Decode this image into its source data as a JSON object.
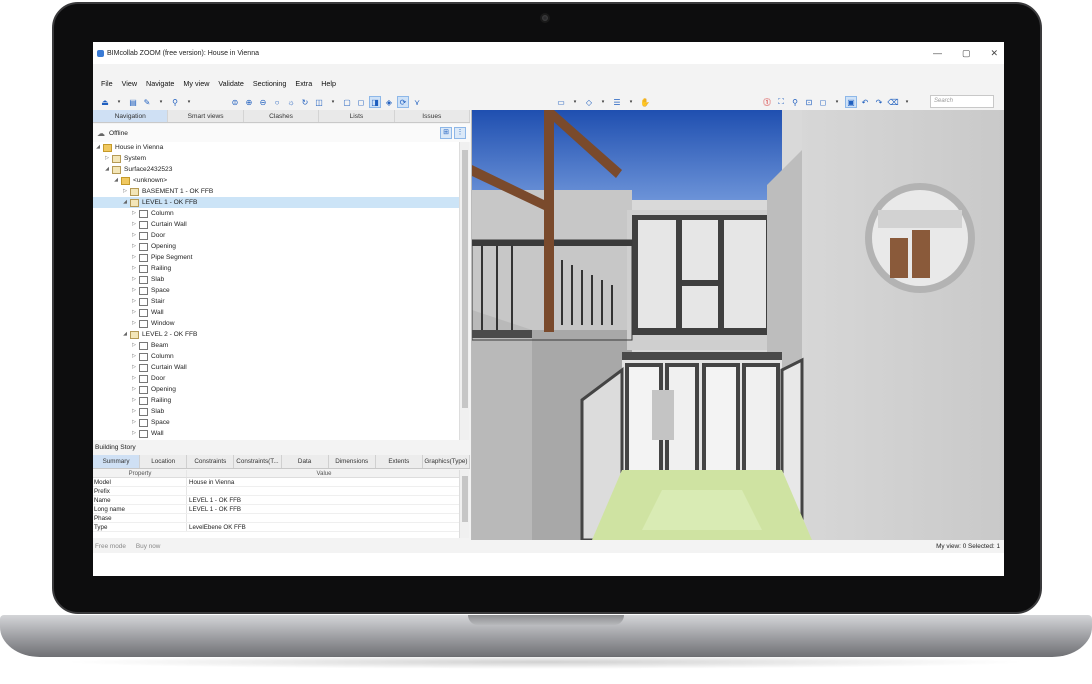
{
  "window": {
    "title": "BIMcollab ZOOM (free version): House in Vienna",
    "controls": [
      "—",
      "▢",
      "✕"
    ]
  },
  "menu": [
    "File",
    "View",
    "Navigate",
    "My view",
    "Validate",
    "Sectioning",
    "Extra",
    "Help"
  ],
  "search": {
    "placeholder": "Search"
  },
  "panel_tabs": [
    "Navigation",
    "Smart views",
    "Clashes",
    "Lists",
    "Issues"
  ],
  "offline_label": "Offline",
  "tree": [
    {
      "label": "House in Vienna",
      "depth": 0,
      "expanded": true,
      "icon": "folder"
    },
    {
      "label": "System",
      "depth": 1,
      "expanded": false,
      "icon": "building"
    },
    {
      "label": "Surface2432523",
      "depth": 1,
      "expanded": true,
      "icon": "site"
    },
    {
      "label": "<unknown>",
      "depth": 2,
      "expanded": true,
      "icon": "folder"
    },
    {
      "label": "BASEMENT 1 - OK FFB",
      "depth": 3,
      "expanded": false,
      "icon": "storey"
    },
    {
      "label": "LEVEL 1 - OK FFB",
      "depth": 3,
      "expanded": true,
      "icon": "storey",
      "selected": true
    },
    {
      "label": "Column",
      "depth": 4,
      "icon": "element"
    },
    {
      "label": "Curtain Wall",
      "depth": 4,
      "icon": "element"
    },
    {
      "label": "Door",
      "depth": 4,
      "icon": "element"
    },
    {
      "label": "Opening",
      "depth": 4,
      "icon": "element"
    },
    {
      "label": "Pipe Segment",
      "depth": 4,
      "icon": "element"
    },
    {
      "label": "Railing",
      "depth": 4,
      "icon": "element"
    },
    {
      "label": "Slab",
      "depth": 4,
      "icon": "element"
    },
    {
      "label": "Space",
      "depth": 4,
      "icon": "element"
    },
    {
      "label": "Stair",
      "depth": 4,
      "icon": "element"
    },
    {
      "label": "Wall",
      "depth": 4,
      "icon": "element"
    },
    {
      "label": "Window",
      "depth": 4,
      "icon": "element"
    },
    {
      "label": "LEVEL 2 - OK FFB",
      "depth": 3,
      "expanded": true,
      "icon": "storey"
    },
    {
      "label": "Beam",
      "depth": 4,
      "icon": "element"
    },
    {
      "label": "Column",
      "depth": 4,
      "icon": "element"
    },
    {
      "label": "Curtain Wall",
      "depth": 4,
      "icon": "element"
    },
    {
      "label": "Door",
      "depth": 4,
      "icon": "element"
    },
    {
      "label": "Opening",
      "depth": 4,
      "icon": "element"
    },
    {
      "label": "Railing",
      "depth": 4,
      "icon": "element"
    },
    {
      "label": "Slab",
      "depth": 4,
      "icon": "element"
    },
    {
      "label": "Space",
      "depth": 4,
      "icon": "element"
    },
    {
      "label": "Wall",
      "depth": 4,
      "icon": "element"
    }
  ],
  "properties": {
    "panel_title": "Building Story",
    "tabs": [
      "Summary",
      "Location",
      "Constraints",
      "Constraints(T...",
      "Data",
      "Dimensions",
      "Extents",
      "Graphics(Type)"
    ],
    "header": {
      "property": "Property",
      "value": "Value"
    },
    "rows": [
      {
        "property": "Model",
        "value": "House in Vienna"
      },
      {
        "property": "Prefix",
        "value": ""
      },
      {
        "property": "Name",
        "value": "LEVEL 1 - OK FFB"
      },
      {
        "property": "Long name",
        "value": "LEVEL 1 - OK FFB"
      },
      {
        "property": "Phase",
        "value": ""
      },
      {
        "property": "Type",
        "value": "LevelEbene OK FFB"
      }
    ]
  },
  "status": {
    "left": [
      "Free mode",
      "Buy now"
    ],
    "right": "My view: 0  Selected: 1"
  }
}
